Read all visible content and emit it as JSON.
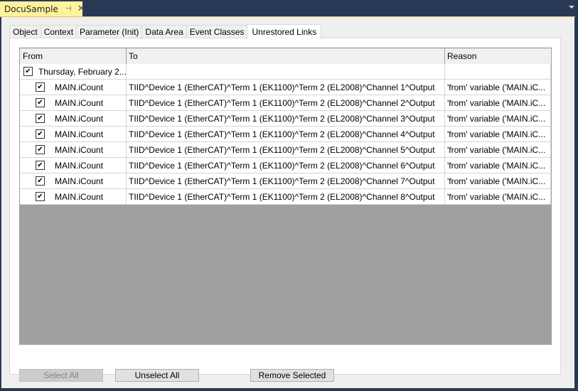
{
  "document_tab": {
    "title": "DocuSample",
    "pin_icon": "pin-icon",
    "close_icon": "close-icon"
  },
  "tabs": [
    {
      "label": "Object",
      "active": false
    },
    {
      "label": "Context",
      "active": false
    },
    {
      "label": "Parameter (Init)",
      "active": false
    },
    {
      "label": "Data Area",
      "active": false
    },
    {
      "label": "Event Classes",
      "active": false
    },
    {
      "label": "Unrestored Links",
      "active": true
    }
  ],
  "grid": {
    "columns": {
      "from": "From",
      "to": "To",
      "reason": "Reason"
    },
    "parent_row": {
      "from": "Thursday, February 2...",
      "to": "",
      "reason": "",
      "checked": true
    },
    "rows": [
      {
        "from": "MAIN.iCount",
        "to": "TIID^Device 1 (EtherCAT)^Term 1 (EK1100)^Term 2 (EL2008)^Channel 1^Output",
        "reason": "'from' variable ('MAIN.iC...",
        "checked": true
      },
      {
        "from": "MAIN.iCount",
        "to": "TIID^Device 1 (EtherCAT)^Term 1 (EK1100)^Term 2 (EL2008)^Channel 2^Output",
        "reason": "'from' variable ('MAIN.iC...",
        "checked": true
      },
      {
        "from": "MAIN.iCount",
        "to": "TIID^Device 1 (EtherCAT)^Term 1 (EK1100)^Term 2 (EL2008)^Channel 3^Output",
        "reason": "'from' variable ('MAIN.iC...",
        "checked": true
      },
      {
        "from": "MAIN.iCount",
        "to": "TIID^Device 1 (EtherCAT)^Term 1 (EK1100)^Term 2 (EL2008)^Channel 4^Output",
        "reason": "'from' variable ('MAIN.iC...",
        "checked": true
      },
      {
        "from": "MAIN.iCount",
        "to": "TIID^Device 1 (EtherCAT)^Term 1 (EK1100)^Term 2 (EL2008)^Channel 5^Output",
        "reason": "'from' variable ('MAIN.iC...",
        "checked": true
      },
      {
        "from": "MAIN.iCount",
        "to": "TIID^Device 1 (EtherCAT)^Term 1 (EK1100)^Term 2 (EL2008)^Channel 6^Output",
        "reason": "'from' variable ('MAIN.iC...",
        "checked": true
      },
      {
        "from": "MAIN.iCount",
        "to": "TIID^Device 1 (EtherCAT)^Term 1 (EK1100)^Term 2 (EL2008)^Channel 7^Output",
        "reason": "'from' variable ('MAIN.iC...",
        "checked": true
      },
      {
        "from": "MAIN.iCount",
        "to": "TIID^Device 1 (EtherCAT)^Term 1 (EK1100)^Term 2 (EL2008)^Channel 8^Output",
        "reason": "'from' variable ('MAIN.iC...",
        "checked": true
      }
    ]
  },
  "buttons": {
    "select_all": {
      "label": "Select All",
      "enabled": false
    },
    "unselect_all": {
      "label": "Unselect All",
      "enabled": true
    },
    "remove_selected": {
      "label": "Remove Selected",
      "enabled": true
    }
  },
  "check_glyph": "✔"
}
